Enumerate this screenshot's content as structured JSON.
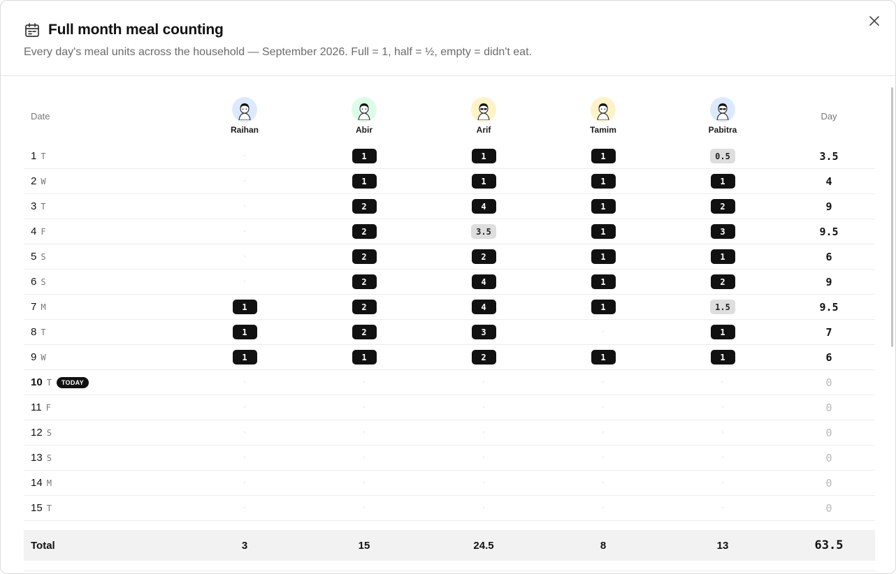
{
  "header": {
    "title": "Full month meal counting",
    "subtitle": "Every day's meal units across the household — September 2026. Full = 1, half = ½, empty = didn't eat."
  },
  "icons": {
    "title": "calendar-icon",
    "close": "close-icon"
  },
  "table": {
    "date_label": "Date",
    "day_label": "Day",
    "today_label": "TODAY",
    "empty_mark": "·",
    "members": [
      {
        "name": "Raihan",
        "avatar_bg": "#dbeafe"
      },
      {
        "name": "Abir",
        "avatar_bg": "#dcfce7"
      },
      {
        "name": "Arif",
        "avatar_bg": "#fdf3c7"
      },
      {
        "name": "Tamim",
        "avatar_bg": "#fdf3c7"
      },
      {
        "name": "Pabitra",
        "avatar_bg": "#dbeafe"
      }
    ],
    "rows": [
      {
        "day": "1",
        "weekday": "T",
        "today": false,
        "cells": [
          "",
          "1",
          "1",
          "1",
          "0.5"
        ],
        "total": "3.5"
      },
      {
        "day": "2",
        "weekday": "W",
        "today": false,
        "cells": [
          "",
          "1",
          "1",
          "1",
          "1"
        ],
        "total": "4"
      },
      {
        "day": "3",
        "weekday": "T",
        "today": false,
        "cells": [
          "",
          "2",
          "4",
          "1",
          "2"
        ],
        "total": "9"
      },
      {
        "day": "4",
        "weekday": "F",
        "today": false,
        "cells": [
          "",
          "2",
          "3.5",
          "1",
          "3"
        ],
        "total": "9.5"
      },
      {
        "day": "5",
        "weekday": "S",
        "today": false,
        "cells": [
          "",
          "2",
          "2",
          "1",
          "1"
        ],
        "total": "6"
      },
      {
        "day": "6",
        "weekday": "S",
        "today": false,
        "cells": [
          "",
          "2",
          "4",
          "1",
          "2"
        ],
        "total": "9"
      },
      {
        "day": "7",
        "weekday": "M",
        "today": false,
        "cells": [
          "1",
          "2",
          "4",
          "1",
          "1.5"
        ],
        "total": "9.5"
      },
      {
        "day": "8",
        "weekday": "T",
        "today": false,
        "cells": [
          "1",
          "2",
          "3",
          "",
          "1"
        ],
        "total": "7"
      },
      {
        "day": "9",
        "weekday": "W",
        "today": false,
        "cells": [
          "1",
          "1",
          "2",
          "1",
          "1"
        ],
        "total": "6"
      },
      {
        "day": "10",
        "weekday": "T",
        "today": true,
        "cells": [
          "",
          "",
          "",
          "",
          ""
        ],
        "total": "0"
      },
      {
        "day": "11",
        "weekday": "F",
        "today": false,
        "cells": [
          "",
          "",
          "",
          "",
          ""
        ],
        "total": "0"
      },
      {
        "day": "12",
        "weekday": "S",
        "today": false,
        "cells": [
          "",
          "",
          "",
          "",
          ""
        ],
        "total": "0"
      },
      {
        "day": "13",
        "weekday": "S",
        "today": false,
        "cells": [
          "",
          "",
          "",
          "",
          ""
        ],
        "total": "0"
      },
      {
        "day": "14",
        "weekday": "M",
        "today": false,
        "cells": [
          "",
          "",
          "",
          "",
          ""
        ],
        "total": "0"
      },
      {
        "day": "15",
        "weekday": "T",
        "today": false,
        "cells": [
          "",
          "",
          "",
          "",
          ""
        ],
        "total": "0"
      }
    ],
    "totals": {
      "label": "Total",
      "values": [
        "3",
        "15",
        "24.5",
        "8",
        "13"
      ],
      "grand": "63.5"
    }
  },
  "colors": {
    "pill": "#111111",
    "half_pill": "#dedede",
    "total_bg": "#f2f2f2"
  }
}
